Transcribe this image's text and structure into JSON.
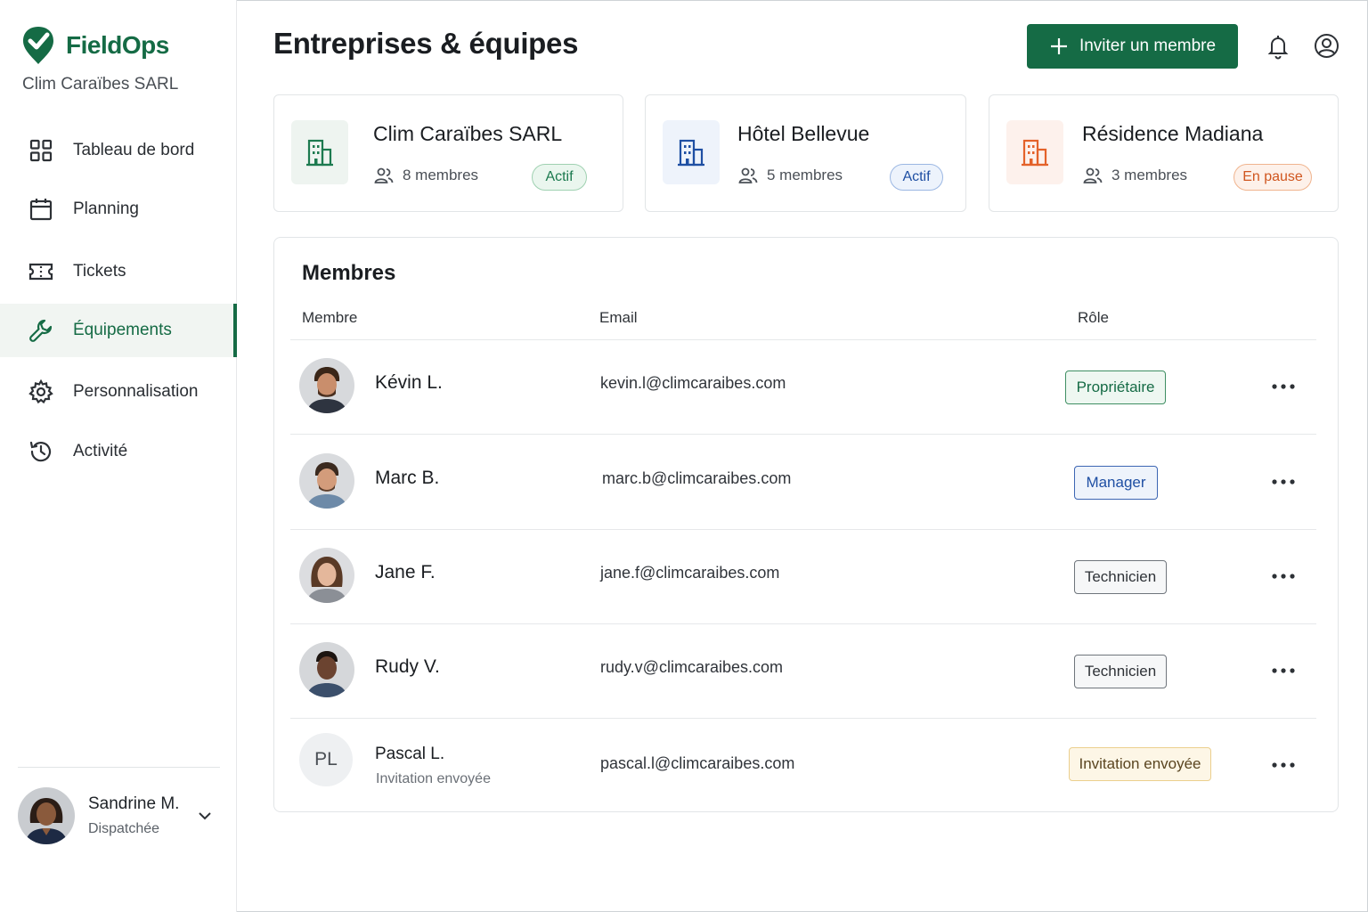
{
  "brand": {
    "name": "FieldOps",
    "org": "Clim Caraïbes SARL",
    "color": "#156b45"
  },
  "nav": [
    {
      "label": "Tableau de bord",
      "icon": "grid-icon"
    },
    {
      "label": "Planning",
      "icon": "calendar-icon"
    },
    {
      "label": "Tickets",
      "icon": "ticket-icon"
    },
    {
      "label": "Équipements",
      "icon": "wrench-icon",
      "active": true
    },
    {
      "label": "Personnalisation",
      "icon": "gear-icon"
    },
    {
      "label": "Activité",
      "icon": "history-icon"
    }
  ],
  "user": {
    "name": "Sandrine M.",
    "role": "Dispatchée"
  },
  "header": {
    "title": "Entreprises & équipes",
    "invite_label": "Inviter un membre"
  },
  "companies": [
    {
      "name": "Clim Caraïbes SARL",
      "members": "8 membres",
      "status": "Actif",
      "status_kind": "active",
      "icon_color": "#1c7a4f"
    },
    {
      "name": "Hôtel Bellevue",
      "members": "5 membres",
      "status": "Actif",
      "status_kind": "active-blue",
      "icon_color": "#1f4fa3"
    },
    {
      "name": "Résidence Madiana",
      "members": "3 membres",
      "status": "En pause",
      "status_kind": "paused",
      "icon_color": "#e4622a"
    }
  ],
  "members_panel": {
    "title": "Membres",
    "columns": {
      "member": "Membre",
      "email": "Email",
      "role": "Rôle"
    },
    "rows": [
      {
        "name": "Kévin L.",
        "email": "kevin.l@climcaraibes.com",
        "role": "Propriétaire",
        "role_kind": "owner"
      },
      {
        "name": "Marc B.",
        "email": "marc.b@climcaraibes.com",
        "role": "Manager",
        "role_kind": "manager"
      },
      {
        "name": "Jane F.",
        "email": "jane.f@climcaraibes.com",
        "role": "Technicien",
        "role_kind": "tech"
      },
      {
        "name": "Rudy V.",
        "email": "rudy.v@climcaraibes.com",
        "role": "Technicien",
        "role_kind": "tech"
      },
      {
        "name": "Pascal L.",
        "sub": "Invitation envoyée",
        "initials": "PL",
        "email": "pascal.l@climcaraibes.com",
        "role": "Invitation envoyée",
        "role_kind": "invited"
      }
    ]
  }
}
